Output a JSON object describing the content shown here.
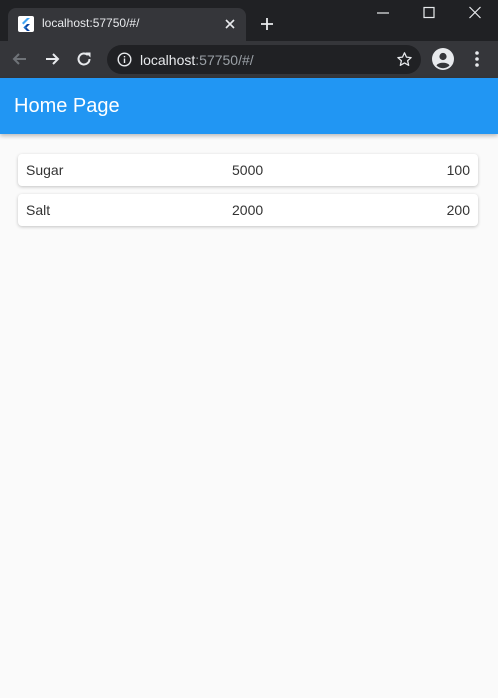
{
  "browser": {
    "tab": {
      "title": "localhost:57750/#/",
      "favicon": "flutter-icon"
    },
    "address_bar": {
      "host": "localhost",
      "rest": ":57750/#/"
    },
    "icons": {
      "back": "arrow-back-icon",
      "forward": "arrow-forward-icon",
      "reload": "reload-icon",
      "info": "info-icon",
      "bookmark": "star-icon",
      "profile": "profile-icon",
      "menu": "more-vert-icon"
    },
    "colors": {
      "frame": "#202124",
      "toolbar": "#35363a",
      "tab_text": "#e8eaed"
    }
  },
  "app": {
    "title": "Home Page",
    "colors": {
      "primary": "#2196f3",
      "background": "#fafafa",
      "card": "#ffffff"
    },
    "items": [
      {
        "name": "Sugar",
        "quantity": "5000",
        "price": "100"
      },
      {
        "name": "Salt",
        "quantity": "2000",
        "price": "200"
      }
    ]
  }
}
